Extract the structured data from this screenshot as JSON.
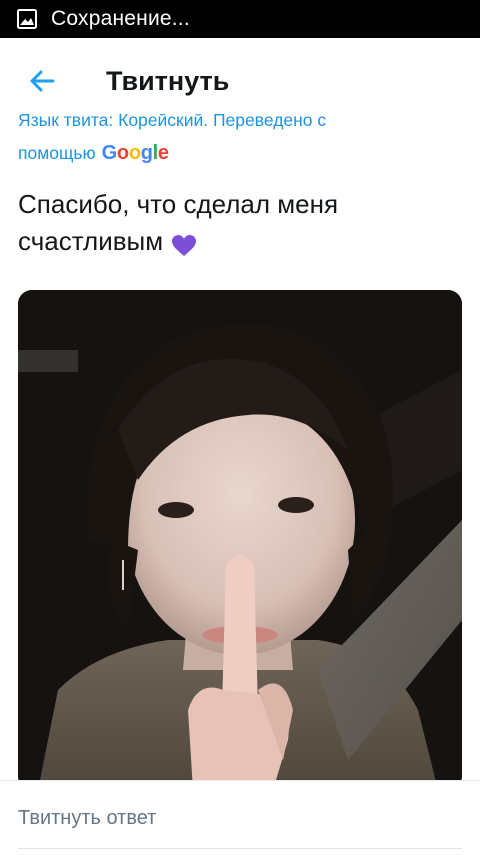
{
  "status_bar": {
    "icon": "image-icon",
    "text": "Сохранение..."
  },
  "app_bar": {
    "back_icon": "arrow-left-icon",
    "title": "Твитнуть"
  },
  "translation": {
    "line1": "Язык твита: Корейский. Переведено с",
    "line2_prefix": "помощью",
    "google": {
      "G": "G",
      "o1": "o",
      "o2": "o",
      "g": "g",
      "l": "l",
      "e": "e"
    },
    "color": "#1b95e0"
  },
  "tweet": {
    "text_line1": "Спасибо, что сделал меня",
    "text_line2": "счастливым",
    "emoji": "purple-heart-icon",
    "emoji_color": "#7b4fd6"
  },
  "media": {
    "type": "photo"
  },
  "reply": {
    "placeholder": "Твитнуть ответ"
  }
}
